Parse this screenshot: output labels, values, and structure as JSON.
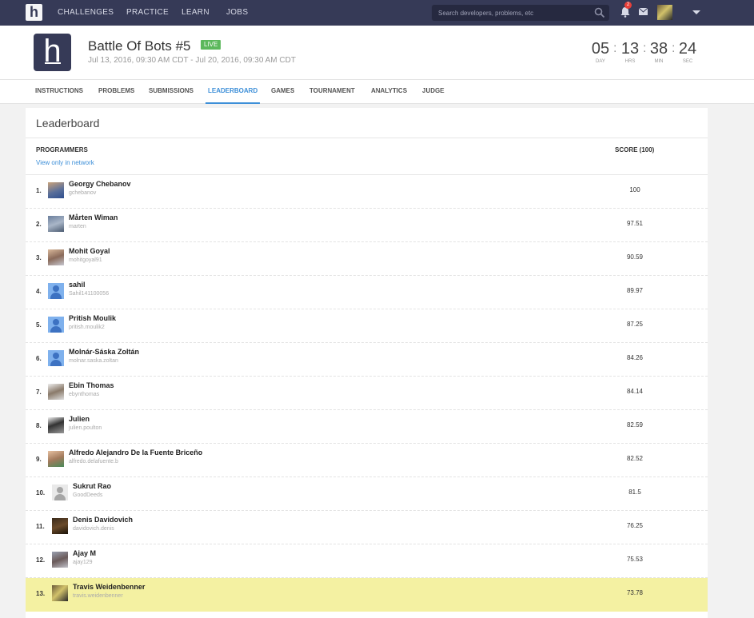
{
  "nav": {
    "logo_letter": "h",
    "links": [
      "CHALLENGES",
      "PRACTICE",
      "LEARN",
      "JOBS"
    ],
    "search_placeholder": "Search developers, problems, etc",
    "notification_count": "2"
  },
  "contest": {
    "title": "Battle Of Bots #5",
    "status": "LIVE",
    "dates": "Jul 13, 2016, 09:30 AM CDT - Jul 20, 2016, 09:30 AM CDT",
    "timer": [
      {
        "value": "05",
        "unit": "DAY"
      },
      {
        "value": "13",
        "unit": "HRS"
      },
      {
        "value": "38",
        "unit": "MIN"
      },
      {
        "value": "24",
        "unit": "SEC"
      }
    ]
  },
  "tabs": [
    "INSTRUCTIONS",
    "PROBLEMS",
    "SUBMISSIONS",
    "LEADERBOARD",
    "GAMES",
    "TOURNAMENT",
    "ANALYTICS",
    "JUDGE"
  ],
  "active_tab": "LEADERBOARD",
  "leaderboard": {
    "title": "Leaderboard",
    "col_programmers": "PROGRAMMERS",
    "network_link": "View only in network",
    "col_score": "SCORE (100)",
    "rows": [
      {
        "rank": "1.",
        "name": "Georgy Chebanov",
        "handle": "gchebanov",
        "score": "100",
        "avatar": "photo"
      },
      {
        "rank": "2.",
        "name": "Mårten Wiman",
        "handle": "marten",
        "score": "97.51",
        "avatar": "photo"
      },
      {
        "rank": "3.",
        "name": "Mohit Goyal",
        "handle": "mohitgoyal91",
        "score": "90.59",
        "avatar": "photo"
      },
      {
        "rank": "4.",
        "name": "sahil",
        "handle": "Sahil141100056",
        "score": "89.97",
        "avatar": "default"
      },
      {
        "rank": "5.",
        "name": "Pritish Moulik",
        "handle": "pritish.moulik2",
        "score": "87.25",
        "avatar": "default"
      },
      {
        "rank": "6.",
        "name": "Molnár-Sáska Zoltán",
        "handle": "molnar.saska.zoltan",
        "score": "84.26",
        "avatar": "default"
      },
      {
        "rank": "7.",
        "name": "Ebin Thomas",
        "handle": "ebynthomas",
        "score": "84.14",
        "avatar": "photo"
      },
      {
        "rank": "8.",
        "name": "Julien",
        "handle": "julien.poulton",
        "score": "82.59",
        "avatar": "photo"
      },
      {
        "rank": "9.",
        "name": "Alfredo Alejandro De la Fuente Briceño",
        "handle": "alfredo.delafuente.b",
        "score": "82.52",
        "avatar": "photo"
      },
      {
        "rank": "10.",
        "name": "Sukrut Rao",
        "handle": "GoodDeeds",
        "score": "81.5",
        "avatar": "grey"
      },
      {
        "rank": "11.",
        "name": "Denis Davidovich",
        "handle": "davidovich.denis",
        "score": "76.25",
        "avatar": "photo"
      },
      {
        "rank": "12.",
        "name": "Ajay M",
        "handle": "ajay129",
        "score": "75.53",
        "avatar": "photo"
      },
      {
        "rank": "13.",
        "name": "Travis Weidenbenner",
        "handle": "travis.weidenbenner",
        "score": "73.78",
        "avatar": "photo",
        "highlight": true
      }
    ]
  },
  "colors": {
    "navbar": "#363a57",
    "accent": "#3d8fd8",
    "live": "#5cb85c",
    "highlight_row": "#f4f1a2"
  }
}
